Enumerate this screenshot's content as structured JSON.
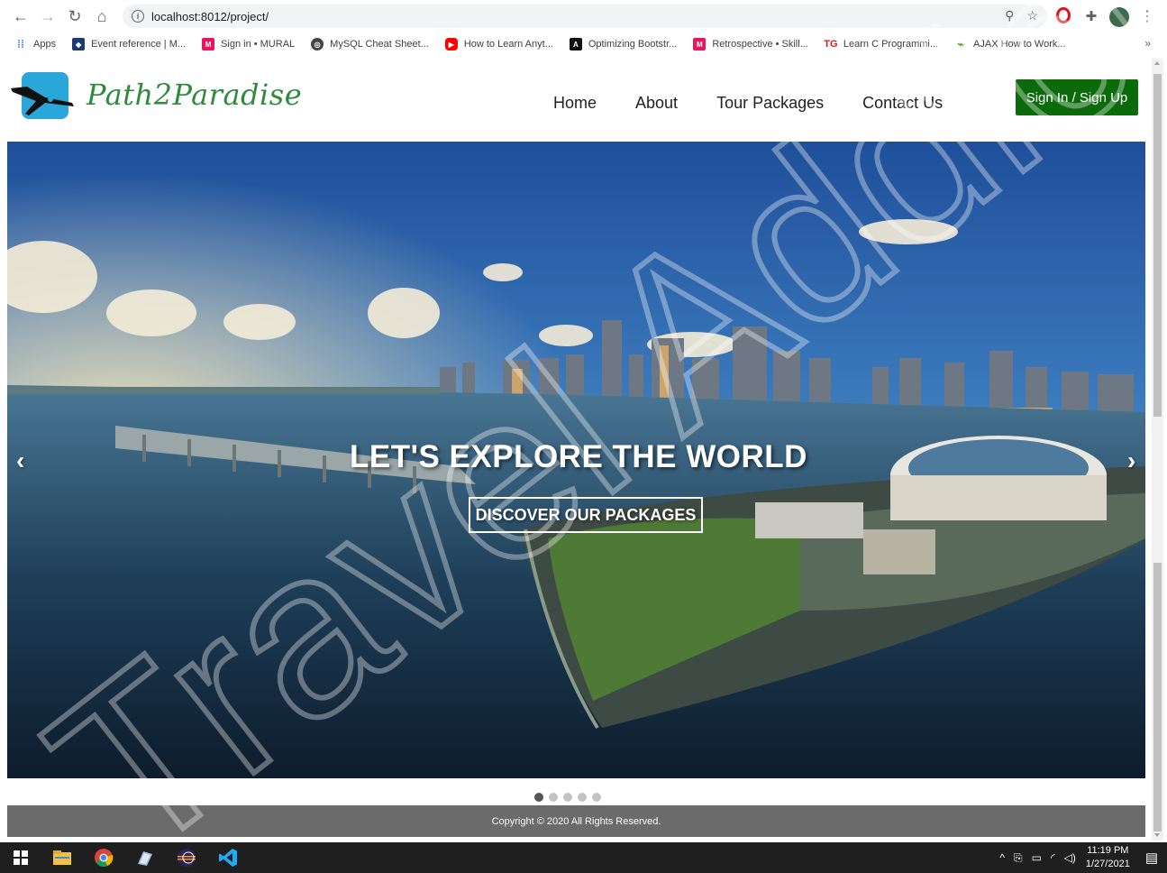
{
  "browser": {
    "url": "localhost:8012/project/",
    "bookmarks": [
      {
        "label": "Apps",
        "color": "#4285f4",
        "glyph": "⋮⋮"
      },
      {
        "label": "Event reference | M...",
        "color": "#1a3c6e",
        "glyph": "◆"
      },
      {
        "label": "Sign in • MURAL",
        "color": "#e8175d",
        "glyph": "M"
      },
      {
        "label": "MySQL Cheat Sheet...",
        "color": "#444",
        "glyph": "◎"
      },
      {
        "label": "How to Learn Anyt...",
        "color": "#ff0000",
        "glyph": "▶"
      },
      {
        "label": "Optimizing Bootstr...",
        "color": "#111",
        "glyph": "A"
      },
      {
        "label": "Retrospective • Skill...",
        "color": "#e8175d",
        "glyph": "M"
      },
      {
        "label": "Learn C Programmi...",
        "color": "#d01c1c",
        "glyph": "TG"
      },
      {
        "label": "AJAX How to Work...",
        "color": "#5aa02c",
        "glyph": "⌁"
      }
    ],
    "more": "»"
  },
  "site": {
    "brand": "Path2Paradise",
    "menu": [
      "Home",
      "About",
      "Tour Packages",
      "Contact Us"
    ],
    "signin": "Sign In / Sign Up"
  },
  "hero": {
    "title": "LET'S EXPLORE THE WORLD",
    "button": "DISCOVER OUR PACKAGES",
    "prev": "‹",
    "next": "›",
    "slides": 5,
    "active_slide": 1
  },
  "footer": {
    "copyright": "Copyright © 2020 All Rights Reserved."
  },
  "watermark": "Travel Addict",
  "taskbar": {
    "time": "11:19 PM",
    "date": "1/27/2021"
  }
}
